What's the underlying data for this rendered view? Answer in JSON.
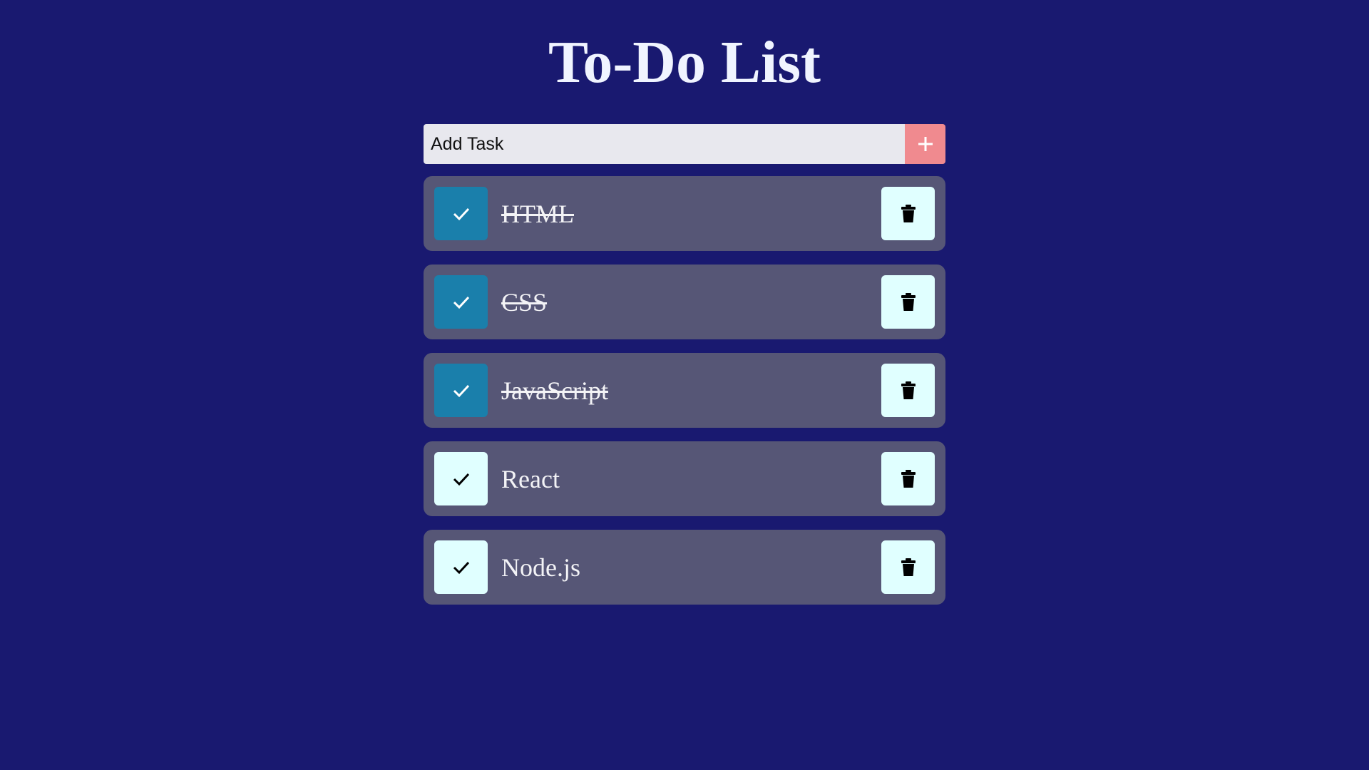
{
  "app": {
    "title": "To-Do List"
  },
  "add_task": {
    "placeholder": "Add Task",
    "button_icon": "plus-icon"
  },
  "tasks": [
    {
      "label": "HTML",
      "completed": true
    },
    {
      "label": "CSS",
      "completed": true
    },
    {
      "label": "JavaScript",
      "completed": true
    },
    {
      "label": "React",
      "completed": false
    },
    {
      "label": "Node.js",
      "completed": false
    }
  ],
  "icons": {
    "check": "check-icon",
    "delete": "trash-icon"
  },
  "colors": {
    "background": "#191970",
    "task_card": "#565676",
    "done_check": "#1a7fab",
    "button_light": "#e0ffff",
    "add_button": "#f08a8f"
  }
}
